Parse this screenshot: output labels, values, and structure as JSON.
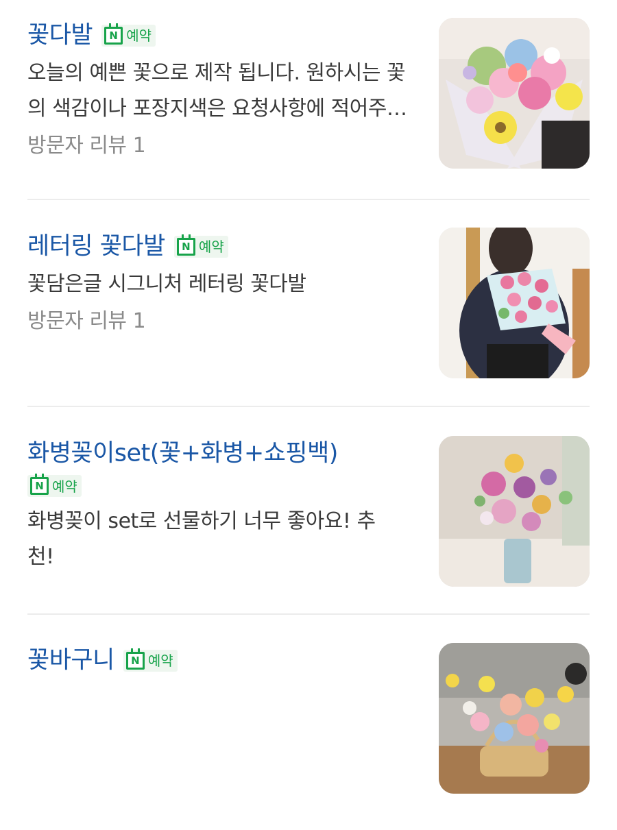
{
  "items": [
    {
      "title": "꽃다발",
      "badge": "예약",
      "badge_icon": "naver-calendar-icon",
      "description": "오늘의 예쁜 꽃으로 제작 됩니다. 원하시는 꽃의 색감이나 포장지색은 요청사항에 적어주세요",
      "review": "방문자 리뷰 1",
      "image": "bouquet-photo"
    },
    {
      "title": "레터링 꽃다발",
      "badge": "예약",
      "badge_icon": "naver-calendar-icon",
      "description": "꽃담은글 시그니처 레터링 꽃다발",
      "review": "방문자 리뷰 1",
      "image": "lettering-bouquet-photo"
    },
    {
      "title": "화병꽂이set(꽃+화병+쇼핑백)",
      "badge": "예약",
      "badge_icon": "naver-calendar-icon",
      "description": "화병꽂이 set로 선물하기 너무 좋아요! 추천!",
      "image": "vase-arrangement-photo"
    },
    {
      "title": "꽃바구니",
      "badge": "예약",
      "badge_icon": "naver-calendar-icon",
      "image": "flower-basket-photo"
    }
  ],
  "badge_letter": "N",
  "colors": {
    "title": "#1a57a6",
    "badge_green": "#17a34a",
    "badge_bg": "#eef6ef",
    "description": "#3a3a3a",
    "review": "#8a8a8a",
    "divider": "#ececec"
  }
}
